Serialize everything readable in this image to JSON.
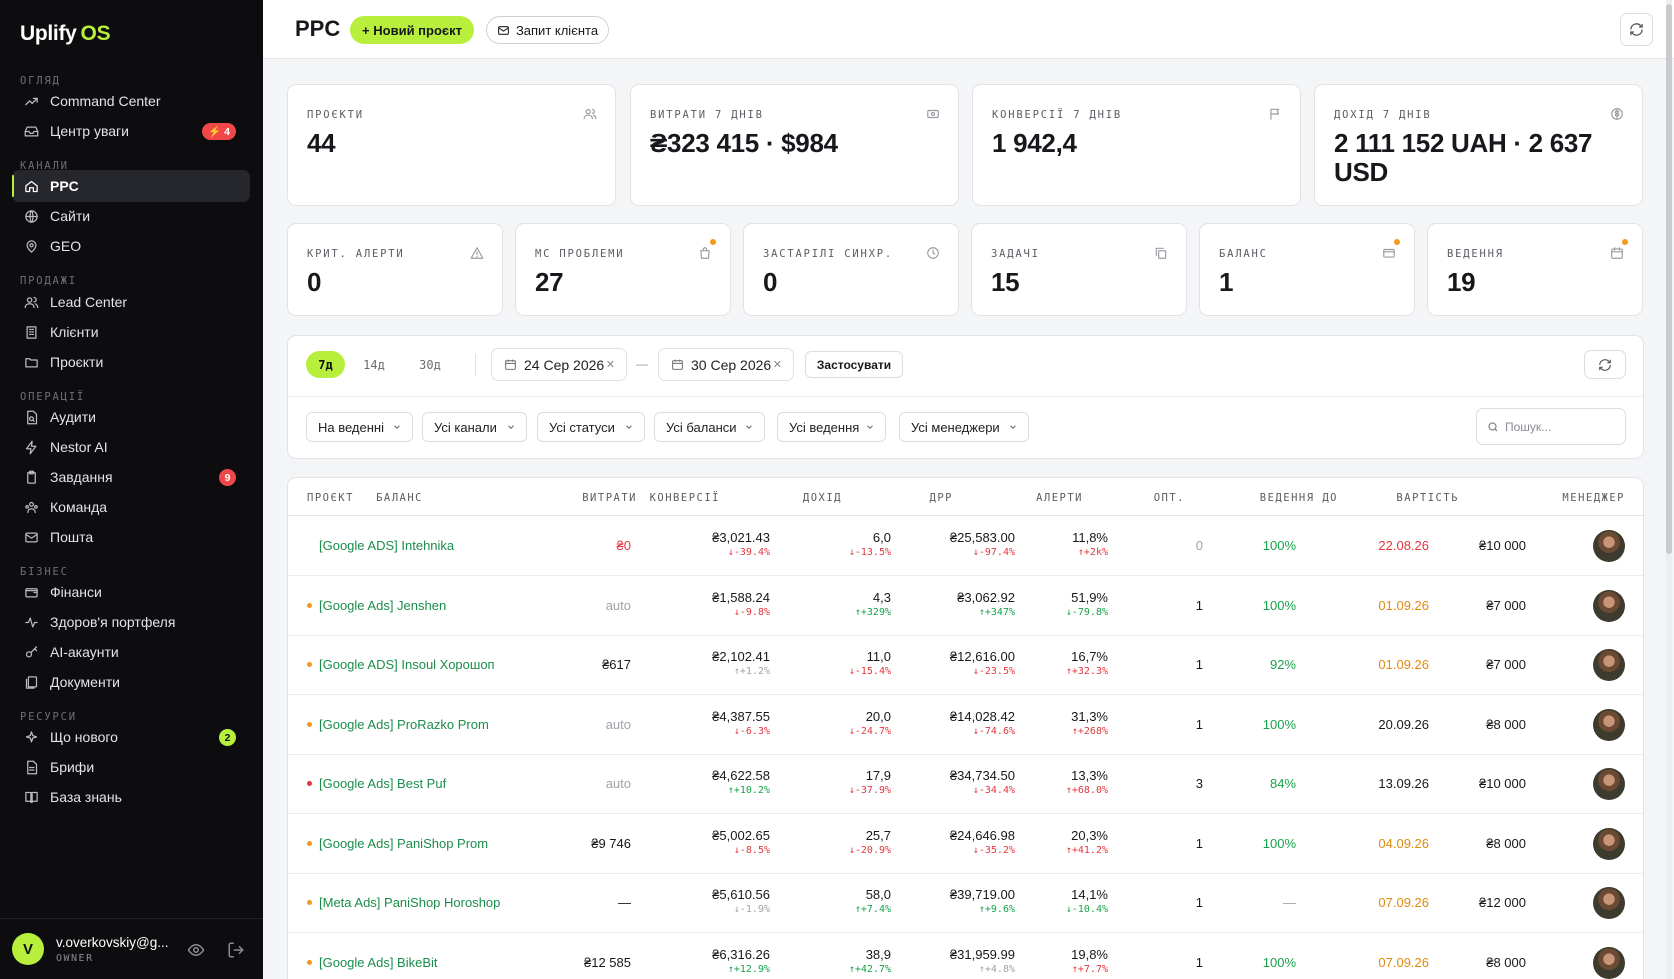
{
  "app": {
    "brand": "Uplify",
    "brand_suffix": "OS"
  },
  "sidebar": {
    "sections": [
      {
        "label": "ОГЛЯД",
        "items": [
          {
            "label": "Command Center",
            "icon": "trend-icon"
          },
          {
            "label": "Центр уваги",
            "icon": "inbox-icon",
            "badge": "⚡ 4"
          }
        ]
      },
      {
        "label": "КАНАЛИ",
        "items": [
          {
            "label": "PPC",
            "icon": "home-icon",
            "active": true
          },
          {
            "label": "Сайти",
            "icon": "globe-icon"
          },
          {
            "label": "GEO",
            "icon": "pin-icon"
          }
        ]
      },
      {
        "label": "ПРОДАЖІ",
        "items": [
          {
            "label": "Lead Center",
            "icon": "users-icon"
          },
          {
            "label": "Клієнти",
            "icon": "building-icon"
          },
          {
            "label": "Проєкти",
            "icon": "folder-icon"
          }
        ]
      },
      {
        "label": "ОПЕРАЦІЇ",
        "items": [
          {
            "label": "Аудити",
            "icon": "file-search-icon"
          },
          {
            "label": "Nestor AI",
            "icon": "bolt-icon"
          },
          {
            "label": "Завдання",
            "icon": "clipboard-icon",
            "badge": "9"
          },
          {
            "label": "Команда",
            "icon": "team-icon"
          },
          {
            "label": "Пошта",
            "icon": "mail-icon"
          }
        ]
      },
      {
        "label": "БІЗНЕС",
        "items": [
          {
            "label": "Фінанси",
            "icon": "wallet-icon"
          },
          {
            "label": "Здоров'я портфеля",
            "icon": "pulse-icon"
          },
          {
            "label": "AI-акаунти",
            "icon": "key-icon"
          },
          {
            "label": "Документи",
            "icon": "documents-icon"
          }
        ]
      },
      {
        "label": "РЕСУРСИ",
        "items": [
          {
            "label": "Що нового",
            "icon": "sparkle-icon",
            "badge": "2"
          },
          {
            "label": "Брифи",
            "icon": "brief-icon"
          },
          {
            "label": "База знань",
            "icon": "book-icon"
          }
        ]
      }
    ],
    "user": {
      "initial": "V",
      "email": "v.overkovskiy@g...",
      "role": "OWNER"
    }
  },
  "header": {
    "title": "PPC",
    "new_project": "+ Новий проєкт",
    "client_request": "Запит клієнта"
  },
  "stats_top": [
    {
      "label": "ПРОЄКТИ",
      "value": "44",
      "icon": "users-icon"
    },
    {
      "label": "ВИТРАТИ 7 ДНІВ",
      "value": "₴323 415 · $984",
      "icon": "money-icon"
    },
    {
      "label": "КОНВЕРСІЇ 7 ДНІВ",
      "value": "1 942,4",
      "icon": "flag-icon"
    },
    {
      "label": "ДОХІД 7 ДНІВ",
      "value": "2 111 152 UAH · 2 637 USD",
      "icon": "dollar-icon"
    }
  ],
  "stats_bottom": [
    {
      "label": "КРИТ. АЛЕРТИ",
      "value": "0",
      "icon": "warning-icon"
    },
    {
      "label": "MC ПРОБЛЕМИ",
      "value": "27",
      "icon": "bag-icon",
      "dot": true
    },
    {
      "label": "ЗАСТАРІЛІ СИНХР.",
      "value": "0",
      "icon": "clock-icon"
    },
    {
      "label": "ЗАДАЧІ",
      "value": "15",
      "icon": "copy-icon"
    },
    {
      "label": "БАЛАНС",
      "value": "1",
      "icon": "card-icon",
      "dot": true
    },
    {
      "label": "ВЕДЕННЯ",
      "value": "19",
      "icon": "calendar-icon",
      "dot": true
    }
  ],
  "filters": {
    "periods": [
      "7д",
      "14д",
      "30д"
    ],
    "active_period": "7д",
    "date_from": "24 Сер 2026",
    "date_to": "30 Сер 2026",
    "dash": "—",
    "apply": "Застосувати",
    "selects": [
      "На веденні",
      "Усі канали",
      "Усі статуси",
      "Усі баланси",
      "Усі ведення",
      "Усі менеджери"
    ],
    "search_placeholder": "Пошук..."
  },
  "table": {
    "columns": [
      "ПРОЄКТ",
      "БАЛАНС",
      "ВИТРАТИ",
      "КОНВЕРСІЇ",
      "ДОХІД",
      "ДРР",
      "АЛЕРТИ",
      "ОПТ.",
      "ВЕДЕННЯ ДО",
      "ВАРТІСТЬ",
      "МЕНЕДЖЕР"
    ],
    "rows": [
      {
        "bullet": "",
        "project": "[Google ADS] Intehnika",
        "balance": "₴0",
        "balance_color": "red",
        "spend": "₴3,021.43",
        "spend_d": "↓-39.4%",
        "spend_dc": "red",
        "conv": "6,0",
        "conv_d": "↓-13.5%",
        "conv_dc": "red",
        "rev": "₴25,583.00",
        "rev_d": "↓-97.4%",
        "rev_dc": "red",
        "drr": "11,8%",
        "drr_d": "↑+2k%",
        "drr_dc": "red",
        "alerts": "0",
        "alerts_color": "gray",
        "opt": "100%",
        "opt_color": "green",
        "until": "22.08.26",
        "until_color": "red",
        "cost": "₴10 000"
      },
      {
        "bullet": "orange",
        "project": "[Google Ads] Jenshen",
        "balance": "auto",
        "balance_color": "gray",
        "spend": "₴1,588.24",
        "spend_d": "↓-9.8%",
        "spend_dc": "red",
        "conv": "4,3",
        "conv_d": "↑+329%",
        "conv_dc": "green",
        "rev": "₴3,062.92",
        "rev_d": "↑+347%",
        "rev_dc": "green",
        "drr": "51,9%",
        "drr_d": "↓-79.8%",
        "drr_dc": "green",
        "alerts": "1",
        "alerts_color": "dark",
        "opt": "100%",
        "opt_color": "green",
        "until": "01.09.26",
        "until_color": "orange",
        "cost": "₴7 000"
      },
      {
        "bullet": "orange",
        "project": "[Google ADS] Insoul Хорошоп",
        "balance": "₴617",
        "balance_color": "dark",
        "spend": "₴2,102.41",
        "spend_d": "↑+1.2%",
        "spend_dc": "gray",
        "conv": "11,0",
        "conv_d": "↓-15.4%",
        "conv_dc": "red",
        "rev": "₴12,616.00",
        "rev_d": "↓-23.5%",
        "rev_dc": "red",
        "drr": "16,7%",
        "drr_d": "↑+32.3%",
        "drr_dc": "red",
        "alerts": "1",
        "alerts_color": "dark",
        "opt": "92%",
        "opt_color": "green",
        "until": "01.09.26",
        "until_color": "orange",
        "cost": "₴7 000"
      },
      {
        "bullet": "orange",
        "project": "[Google Ads] ProRazko Prom",
        "balance": "auto",
        "balance_color": "gray",
        "spend": "₴4,387.55",
        "spend_d": "↓-6.3%",
        "spend_dc": "red",
        "conv": "20,0",
        "conv_d": "↓-24.7%",
        "conv_dc": "red",
        "rev": "₴14,028.42",
        "rev_d": "↓-74.6%",
        "rev_dc": "red",
        "drr": "31,3%",
        "drr_d": "↑+268%",
        "drr_dc": "red",
        "alerts": "1",
        "alerts_color": "dark",
        "opt": "100%",
        "opt_color": "green",
        "until": "20.09.26",
        "until_color": "dark",
        "cost": "₴8 000"
      },
      {
        "bullet": "red",
        "project": "[Google Ads] Best Puf",
        "balance": "auto",
        "balance_color": "gray",
        "spend": "₴4,622.58",
        "spend_d": "↑+10.2%",
        "spend_dc": "green",
        "conv": "17,9",
        "conv_d": "↓-37.9%",
        "conv_dc": "red",
        "rev": "₴34,734.50",
        "rev_d": "↓-34.4%",
        "rev_dc": "red",
        "drr": "13,3%",
        "drr_d": "↑+68.0%",
        "drr_dc": "red",
        "alerts": "3",
        "alerts_color": "dark",
        "opt": "84%",
        "opt_color": "green",
        "until": "13.09.26",
        "until_color": "dark",
        "cost": "₴10 000"
      },
      {
        "bullet": "orange",
        "project": "[Google Ads] PaniShop Prom",
        "balance": "₴9 746",
        "balance_color": "dark",
        "spend": "₴5,002.65",
        "spend_d": "↓-8.5%",
        "spend_dc": "red",
        "conv": "25,7",
        "conv_d": "↓-20.9%",
        "conv_dc": "red",
        "rev": "₴24,646.98",
        "rev_d": "↓-35.2%",
        "rev_dc": "red",
        "drr": "20,3%",
        "drr_d": "↑+41.2%",
        "drr_dc": "red",
        "alerts": "1",
        "alerts_color": "dark",
        "opt": "100%",
        "opt_color": "green",
        "until": "04.09.26",
        "until_color": "orange",
        "cost": "₴8 000"
      },
      {
        "bullet": "orange",
        "project": "[Meta Ads] PaniShop Horoshop",
        "balance": "—",
        "balance_color": "dark",
        "spend": "₴5,610.56",
        "spend_d": "↓-1.9%",
        "spend_dc": "gray",
        "conv": "58,0",
        "conv_d": "↑+7.4%",
        "conv_dc": "green",
        "rev": "₴39,719.00",
        "rev_d": "↑+9.6%",
        "rev_dc": "green",
        "drr": "14,1%",
        "drr_d": "↓-10.4%",
        "drr_dc": "green",
        "alerts": "1",
        "alerts_color": "dark",
        "opt": "—",
        "opt_color": "gray",
        "until": "07.09.26",
        "until_color": "orange",
        "cost": "₴12 000"
      },
      {
        "bullet": "orange",
        "project": "[Google Ads] BikeBit",
        "balance": "₴12 585",
        "balance_color": "dark",
        "spend": "₴6,316.26",
        "spend_d": "↑+12.9%",
        "spend_dc": "green",
        "conv": "38,9",
        "conv_d": "↑+42.7%",
        "conv_dc": "green",
        "rev": "₴31,959.99",
        "rev_d": "↑+4.8%",
        "rev_dc": "gray",
        "drr": "19,8%",
        "drr_d": "↑+7.7%",
        "drr_dc": "red",
        "alerts": "1",
        "alerts_color": "dark",
        "opt": "100%",
        "opt_color": "green",
        "until": "07.09.26",
        "until_color": "orange",
        "cost": "₴8 000"
      }
    ]
  },
  "colors": {
    "accent": "#b7ef3c",
    "red": "#e2373f",
    "green": "#17a34a",
    "orange": "#e08a0e",
    "sidebar": "#0d0d10"
  }
}
